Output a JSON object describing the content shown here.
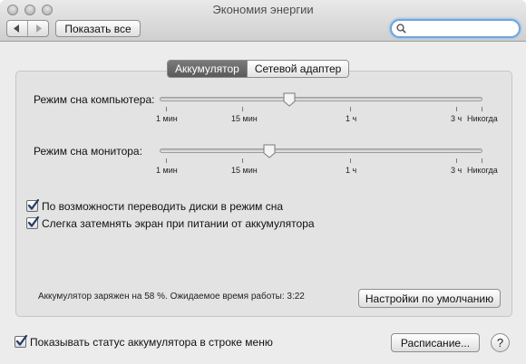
{
  "window": {
    "title": "Экономия энергии"
  },
  "toolbar": {
    "back_icon": "chevron-left-icon",
    "forward_icon": "chevron-right-icon",
    "show_all_label": "Показать все",
    "search": {
      "placeholder": "",
      "value": "",
      "icon": "search-icon"
    }
  },
  "tabs": [
    {
      "label": "Аккумулятор",
      "active": true
    },
    {
      "label": "Сетевой адаптер",
      "active": false
    }
  ],
  "computer_sleep": {
    "label": "Режим сна компьютера:",
    "value": "1 ч",
    "ticks": [
      "1 мин",
      "15 мин",
      "1 ч",
      "3 ч",
      "Никогда"
    ]
  },
  "display_sleep": {
    "label": "Режим сна монитора:",
    "value": "15 мин",
    "ticks": [
      "1 мин",
      "15 мин",
      "1 ч",
      "3 ч",
      "Никогда"
    ]
  },
  "options": [
    {
      "label": "По возможности переводить диски в режим сна",
      "checked": true
    },
    {
      "label": "Слегка затемнять экран при питании от аккумулятора",
      "checked": true
    }
  ],
  "battery_status": "Аккумулятор заряжен на 58 %. Ожидаемое время работы: 3:22",
  "restore_defaults_label": "Настройки по умолчанию",
  "show_status_in_menu": {
    "label": "Показывать статус аккумулятора в строке меню",
    "checked": true
  },
  "schedule_label": "Расписание...",
  "help_label": "?",
  "colors": {
    "accent": "#2b6fcf",
    "focus_ring": "#6fa5d8",
    "window_bg": "#ececec"
  }
}
